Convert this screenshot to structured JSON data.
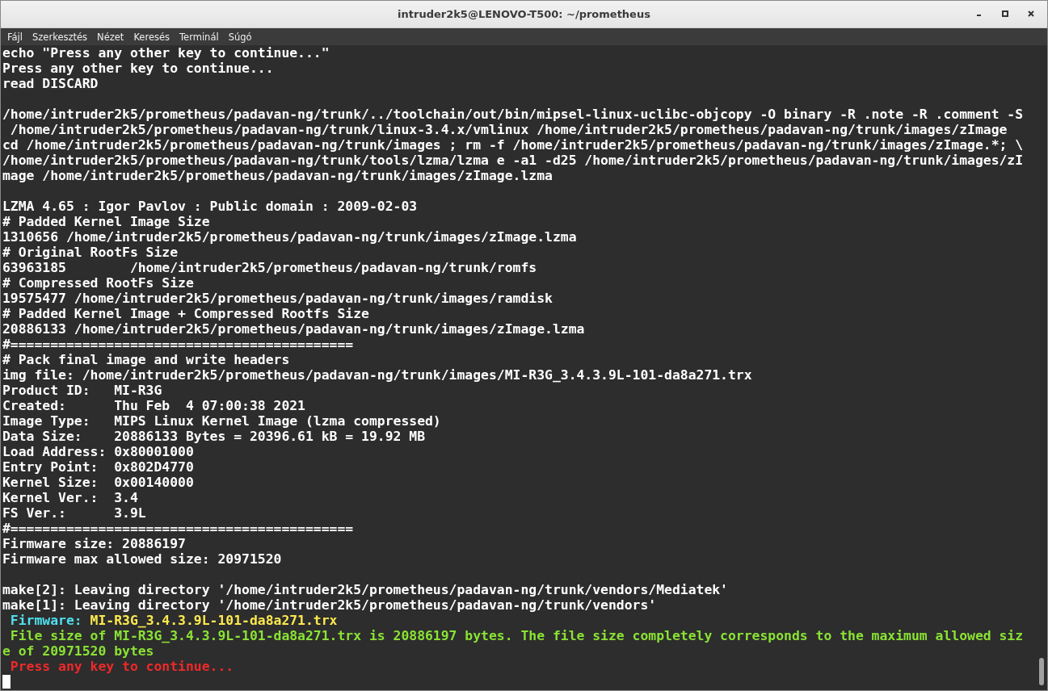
{
  "window": {
    "title": "intruder2k5@LENOVO-T500: ~/prometheus"
  },
  "menu": [
    "Fájl",
    "Szerkesztés",
    "Nézet",
    "Keresés",
    "Terminál",
    "Súgó"
  ],
  "terminal": {
    "blocks": [
      [
        {
          "segments": [
            {
              "text": "echo \"Press any other key to continue...\""
            }
          ]
        },
        {
          "segments": [
            {
              "text": "Press any other key to continue..."
            }
          ]
        },
        {
          "segments": [
            {
              "text": "read DISCARD"
            }
          ]
        }
      ],
      [
        {
          "segments": [
            {
              "text": "/home/intruder2k5/prometheus/padavan-ng/trunk/../toolchain/out/bin/mipsel-linux-uclibc-objcopy -O binary -R .note -R .comment -S"
            }
          ]
        },
        {
          "segments": [
            {
              "text": " /home/intruder2k5/prometheus/padavan-ng/trunk/linux-3.4.x/vmlinux /home/intruder2k5/prometheus/padavan-ng/trunk/images/zImage"
            }
          ]
        },
        {
          "segments": [
            {
              "text": "cd /home/intruder2k5/prometheus/padavan-ng/trunk/images ; rm -f /home/intruder2k5/prometheus/padavan-ng/trunk/images/zImage.*; \\"
            }
          ]
        },
        {
          "segments": [
            {
              "text": "/home/intruder2k5/prometheus/padavan-ng/trunk/tools/lzma/lzma e -a1 -d25 /home/intruder2k5/prometheus/padavan-ng/trunk/images/zI"
            }
          ]
        },
        {
          "segments": [
            {
              "text": "mage /home/intruder2k5/prometheus/padavan-ng/trunk/images/zImage.lzma"
            }
          ]
        }
      ],
      [
        {
          "segments": [
            {
              "text": "LZMA 4.65 : Igor Pavlov : Public domain : 2009-02-03"
            }
          ]
        },
        {
          "segments": [
            {
              "text": "# Padded Kernel Image Size"
            }
          ]
        },
        {
          "segments": [
            {
              "text": "1310656 /home/intruder2k5/prometheus/padavan-ng/trunk/images/zImage.lzma"
            }
          ]
        },
        {
          "segments": [
            {
              "text": "# Original RootFs Size"
            }
          ]
        },
        {
          "segments": [
            {
              "text": "63963185        /home/intruder2k5/prometheus/padavan-ng/trunk/romfs"
            }
          ]
        },
        {
          "segments": [
            {
              "text": "# Compressed RootFs Size"
            }
          ]
        },
        {
          "segments": [
            {
              "text": "19575477 /home/intruder2k5/prometheus/padavan-ng/trunk/images/ramdisk"
            }
          ]
        },
        {
          "segments": [
            {
              "text": "# Padded Kernel Image + Compressed Rootfs Size"
            }
          ]
        },
        {
          "segments": [
            {
              "text": "20886133 /home/intruder2k5/prometheus/padavan-ng/trunk/images/zImage.lzma"
            }
          ]
        },
        {
          "segments": [
            {
              "text": "#==========================================="
            }
          ]
        },
        {
          "segments": [
            {
              "text": "# Pack final image and write headers"
            }
          ]
        },
        {
          "segments": [
            {
              "text": "img file: /home/intruder2k5/prometheus/padavan-ng/trunk/images/MI-R3G_3.4.3.9L-101-da8a271.trx"
            }
          ]
        },
        {
          "segments": [
            {
              "text": "Product ID:   MI-R3G"
            }
          ]
        },
        {
          "segments": [
            {
              "text": "Created:      Thu Feb  4 07:00:38 2021"
            }
          ]
        },
        {
          "segments": [
            {
              "text": "Image Type:   MIPS Linux Kernel Image (lzma compressed)"
            }
          ]
        },
        {
          "segments": [
            {
              "text": "Data Size:    20886133 Bytes = 20396.61 kB = 19.92 MB"
            }
          ]
        },
        {
          "segments": [
            {
              "text": "Load Address: 0x80001000"
            }
          ]
        },
        {
          "segments": [
            {
              "text": "Entry Point:  0x802D4770"
            }
          ]
        },
        {
          "segments": [
            {
              "text": "Kernel Size:  0x00140000"
            }
          ]
        },
        {
          "segments": [
            {
              "text": "Kernel Ver.:  3.4"
            }
          ]
        },
        {
          "segments": [
            {
              "text": "FS Ver.:      3.9L"
            }
          ]
        },
        {
          "segments": [
            {
              "text": "#==========================================="
            }
          ]
        },
        {
          "segments": [
            {
              "text": "Firmware size: 20886197"
            }
          ]
        },
        {
          "segments": [
            {
              "text": "Firmware max allowed size: 20971520"
            }
          ]
        }
      ],
      [
        {
          "segments": [
            {
              "text": "make[2]: Leaving directory '/home/intruder2k5/prometheus/padavan-ng/trunk/vendors/Mediatek'"
            }
          ]
        },
        {
          "segments": [
            {
              "text": "make[1]: Leaving directory '/home/intruder2k5/prometheus/padavan-ng/trunk/vendors'"
            }
          ]
        },
        {
          "segments": [
            {
              "text": " Firmware:",
              "color": "#4fe0f0"
            },
            {
              "text": " MI-R3G_3.4.3.9L-101-da8a271.trx",
              "color": "#fce94f"
            }
          ]
        },
        {
          "segments": [
            {
              "text": " File size of MI-R3G_3.4.3.9L-101-da8a271.trx is 20886197 bytes. The file size completely corresponds to the maximum allowed siz",
              "color": "#8ae234"
            }
          ]
        },
        {
          "segments": [
            {
              "text": "e of 20971520 bytes",
              "color": "#8ae234"
            }
          ]
        },
        {
          "segments": [
            {
              "text": " Press any key to continue...",
              "color": "#ef2929"
            }
          ]
        }
      ]
    ]
  }
}
